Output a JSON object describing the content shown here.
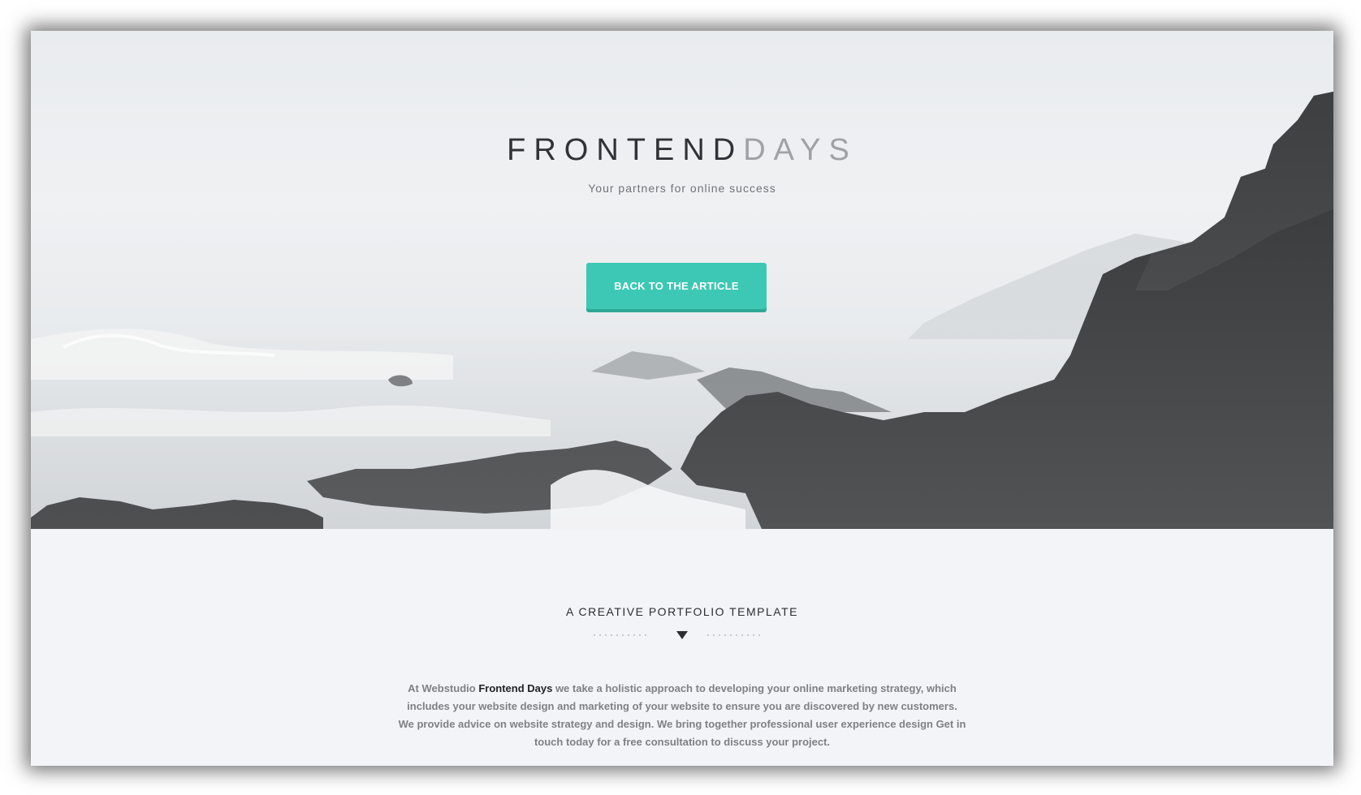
{
  "hero": {
    "title_dark": "FRONTEND",
    "title_light": "DAYS",
    "subtitle": "Your partners for online success",
    "cta_label": "BACK TO THE ARTICLE",
    "background_image": "misty-coastline-photo"
  },
  "intro": {
    "heading": "A CREATIVE PORTFOLIO TEMPLATE",
    "divider_icon": "triangle-down-icon",
    "text_before": "At Webstudio ",
    "brand": "Frontend Days",
    "text_after": " we take a holistic approach to developing your online marketing strategy, which includes your website design and marketing of your website to ensure you are discovered by new customers. We provide advice on website strategy and design. We bring together professional user experience design Get in touch today for a free consultation to discuss your project."
  },
  "colors": {
    "accent": "#3cc8b4",
    "page_background": "#f3f4f7",
    "title_dark": "#2f3237",
    "title_light": "#9ea2a7"
  }
}
